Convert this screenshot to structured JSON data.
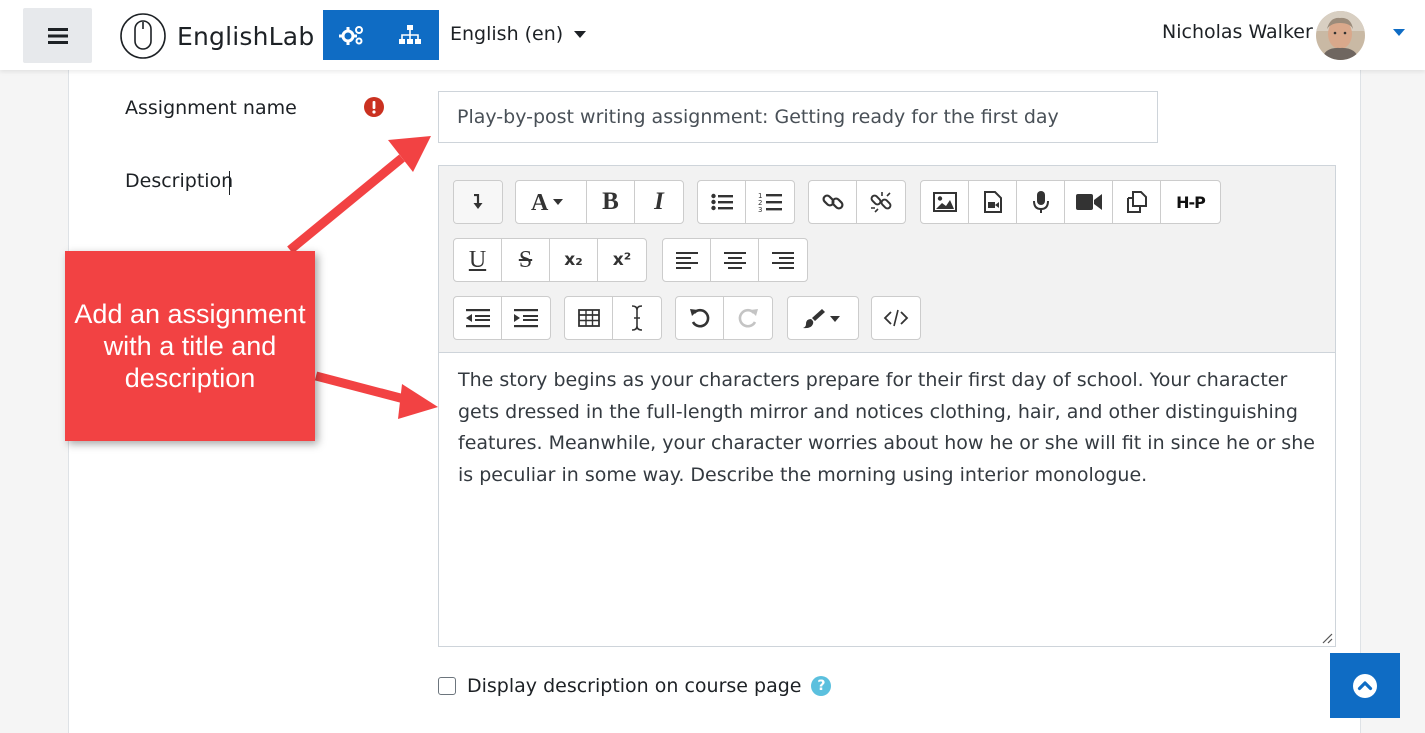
{
  "navbar": {
    "menu_icon": "hamburger-menu-icon",
    "brand": "EnglishLab",
    "brand_icon": "mouse-logo-icon",
    "admin_icon": "gears-icon",
    "sitemap_icon": "sitemap-icon",
    "language": "English ‎(en)‎",
    "user_name": "Nicholas Walker"
  },
  "form": {
    "assignment_name_label": "Assignment name",
    "assignment_name_value": "Play-by-post writing assignment: Getting ready for the first day",
    "description_label": "Description",
    "description_text": "The story begins as your characters prepare for their first day of school. Your character gets dressed in the full-length mirror and notices clothing, hair, and other distinguishing features. Meanwhile, your character worries about how he or she will fit in since he or she is peculiar in some way. Describe the morning using interior monologue.",
    "display_description_label": "Display description on course page"
  },
  "toolbar": {
    "bold": "B",
    "italic": "I",
    "subscript": "x₂",
    "superscript": "x²",
    "h5p": "H-P"
  },
  "callout": {
    "text": "Add an assignment with a title and description"
  },
  "colors": {
    "primary": "#0f6cc4",
    "callout": "#f24243",
    "required": "#ca3120",
    "help": "#5bc0de"
  }
}
